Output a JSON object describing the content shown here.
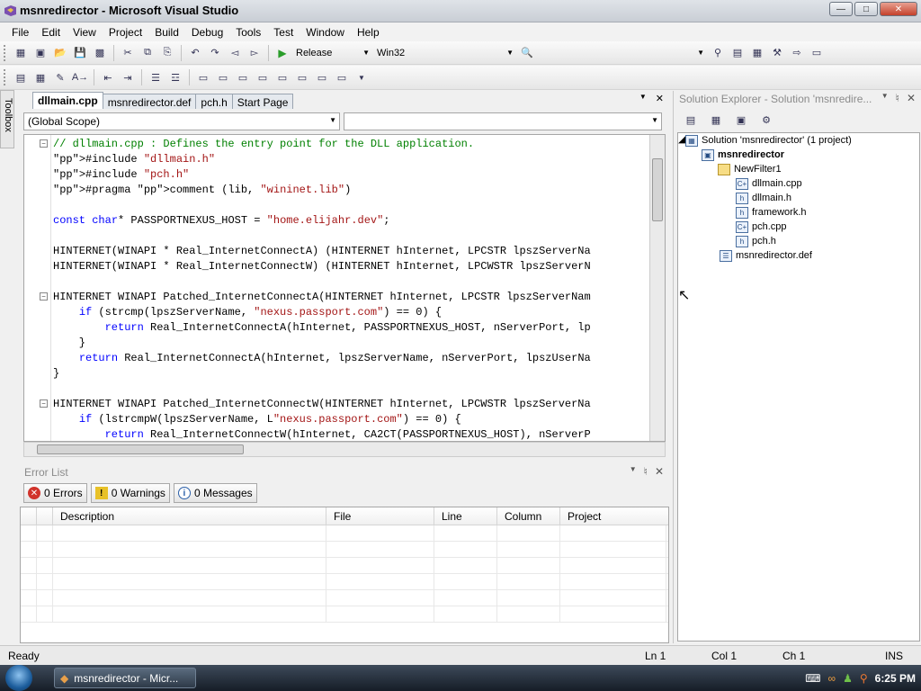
{
  "window": {
    "title": "msnredirector - Microsoft Visual Studio"
  },
  "menu": [
    "File",
    "Edit",
    "View",
    "Project",
    "Build",
    "Debug",
    "Tools",
    "Test",
    "Window",
    "Help"
  ],
  "toolbar": {
    "config": "Release",
    "platform": "Win32"
  },
  "toolbox_label": "Toolbox",
  "tabs": [
    "dllmain.cpp",
    "msnredirector.def",
    "pch.h",
    "Start Page"
  ],
  "scope": {
    "left": "(Global Scope)",
    "right": ""
  },
  "code_lines": [
    "// dllmain.cpp : Defines the entry point for the DLL application.",
    "#include \"dllmain.h\"",
    "#include \"pch.h\"",
    "#pragma comment (lib, \"wininet.lib\")",
    "",
    "const char* PASSPORTNEXUS_HOST = \"home.elijahr.dev\";",
    "",
    "HINTERNET(WINAPI * Real_InternetConnectA) (HINTERNET hInternet, LPCSTR lpszServerNa",
    "HINTERNET(WINAPI * Real_InternetConnectW) (HINTERNET hInternet, LPCWSTR lpszServerN",
    "",
    "HINTERNET WINAPI Patched_InternetConnectA(HINTERNET hInternet, LPCSTR lpszServerNam",
    "    if (strcmp(lpszServerName, \"nexus.passport.com\") == 0) {",
    "        return Real_InternetConnectA(hInternet, PASSPORTNEXUS_HOST, nServerPort, lp",
    "    }",
    "    return Real_InternetConnectA(hInternet, lpszServerName, nServerPort, lpszUserNa",
    "}",
    "",
    "HINTERNET WINAPI Patched_InternetConnectW(HINTERNET hInternet, LPCWSTR lpszServerNa",
    "    if (lstrcmpW(lpszServerName, L\"nexus.passport.com\") == 0) {",
    "        return Real_InternetConnectW(hInternet, CA2CT(PASSPORTNEXUS_HOST), nServerP"
  ],
  "solution_explorer": {
    "title": "Solution Explorer - Solution 'msnredire...",
    "solution": "Solution 'msnredirector' (1 project)",
    "project": "msnredirector",
    "folder": "NewFilter1",
    "files": [
      "dllmain.cpp",
      "dllmain.h",
      "framework.h",
      "pch.cpp",
      "pch.h"
    ],
    "def_file": "msnredirector.def"
  },
  "error_list": {
    "title": "Error List",
    "errors": "0 Errors",
    "warnings": "0 Warnings",
    "messages": "0 Messages",
    "columns": [
      "Description",
      "File",
      "Line",
      "Column",
      "Project"
    ]
  },
  "status": {
    "ready": "Ready",
    "ln": "Ln 1",
    "col": "Col 1",
    "ch": "Ch 1",
    "ins": "INS"
  },
  "taskbar": {
    "button": "msnredirector - Micr...",
    "clock": "6:25 PM"
  },
  "colors": {
    "keyword": "#0000ff",
    "string": "#a31515",
    "comment": "#008000"
  }
}
